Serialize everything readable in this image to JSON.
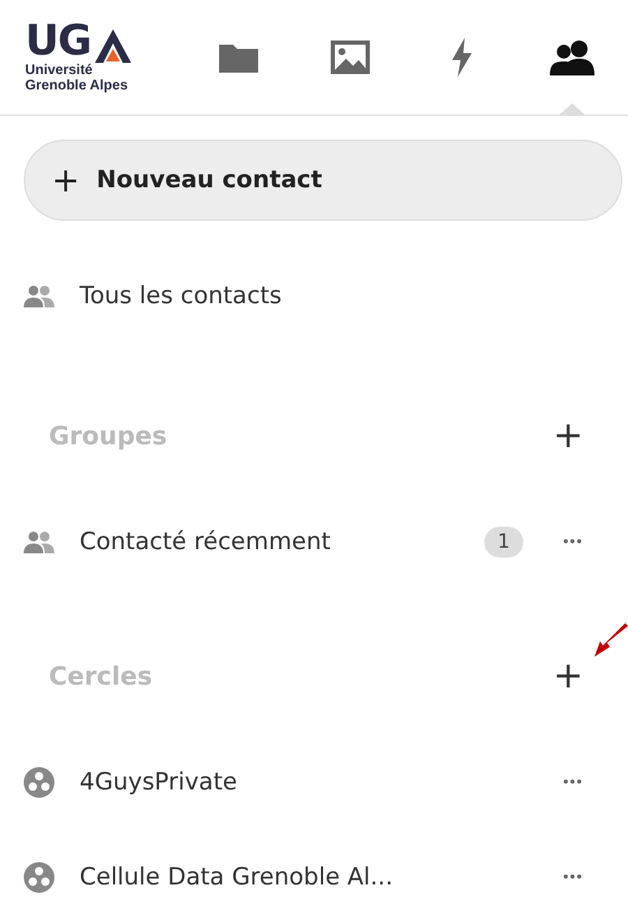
{
  "logo": {
    "letters": "UG",
    "caption": [
      "Université",
      "Grenoble Alpes"
    ]
  },
  "apps": [
    {
      "kind": "folder",
      "selected": false
    },
    {
      "kind": "image",
      "selected": false
    },
    {
      "kind": "bolt",
      "selected": false
    },
    {
      "kind": "people",
      "selected": true
    }
  ],
  "new_contact": {
    "icon": "+",
    "label": "Nouveau contact"
  },
  "all_contacts": {
    "label": "Tous les contacts"
  },
  "sections": [
    {
      "title": "Groupes",
      "add": "+",
      "items": [
        {
          "kind": "group",
          "label": "Contacté récemment",
          "count": "1",
          "menu": "•••"
        }
      ]
    },
    {
      "title": "Cercles",
      "add": "+",
      "annotated": true,
      "items": [
        {
          "kind": "circle",
          "label": "4GuysPrivate",
          "menu": "•••"
        },
        {
          "kind": "circle",
          "label": "Cellule Data Grenoble Al...",
          "menu": "•••"
        }
      ]
    }
  ]
}
